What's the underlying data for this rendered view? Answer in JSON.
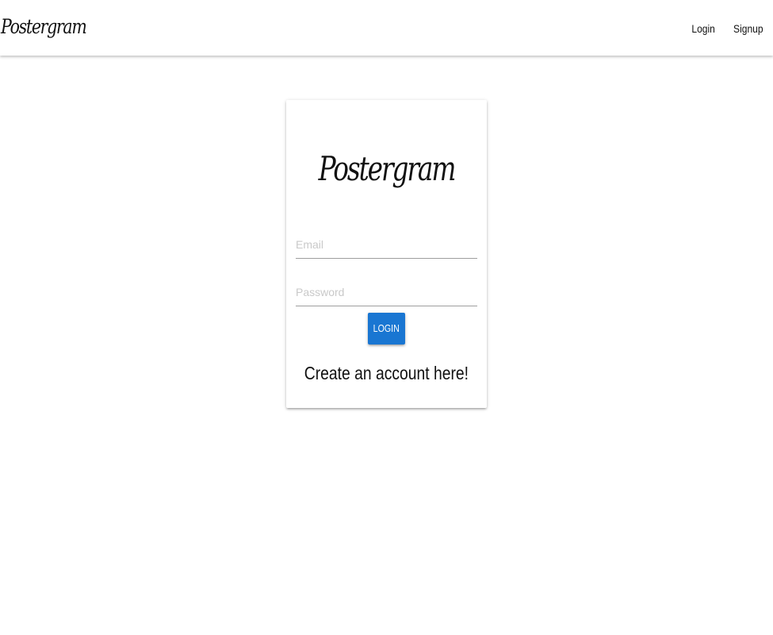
{
  "header": {
    "brand": "Postergram",
    "links": [
      {
        "label": "Login"
      },
      {
        "label": "Signup"
      }
    ]
  },
  "login_card": {
    "brand": "Postergram",
    "email": {
      "placeholder": "Email",
      "value": ""
    },
    "password": {
      "placeholder": "Password",
      "value": ""
    },
    "button_label": "LOGIN",
    "signup_prompt": "Create an account here!"
  },
  "colors": {
    "accent": "#1976d2",
    "text": "#111111",
    "placeholder": "#c9c9c9",
    "divider": "#9e9e9e"
  }
}
